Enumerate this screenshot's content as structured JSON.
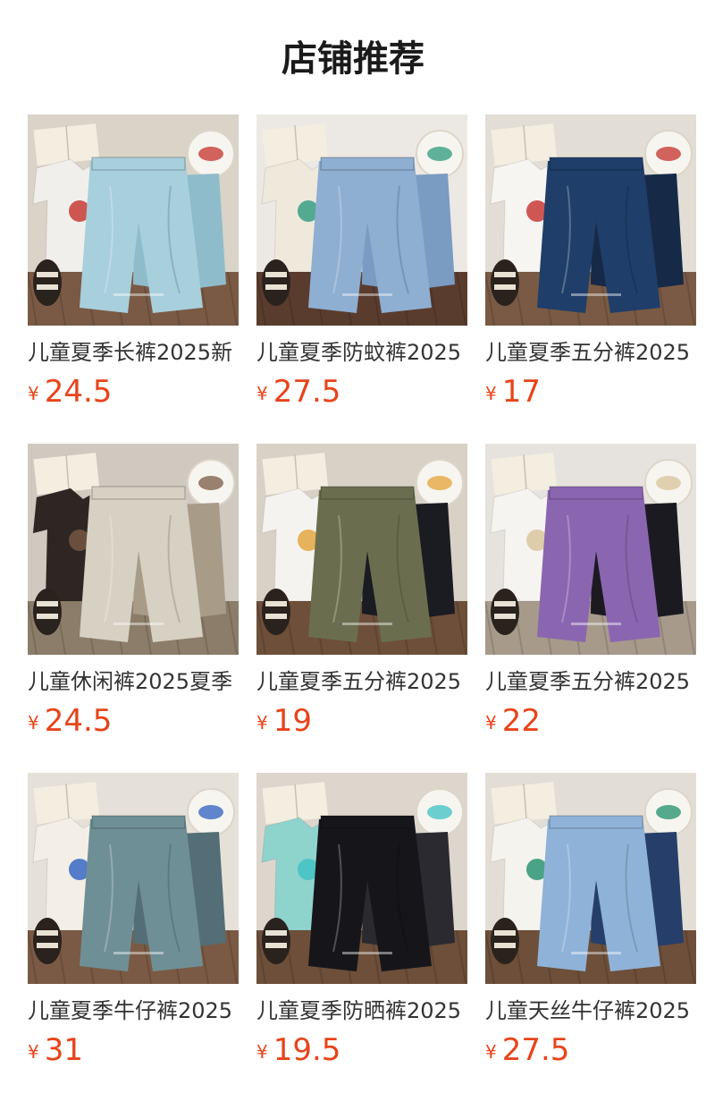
{
  "header": {
    "title": "店铺推荐"
  },
  "currency_symbol": "¥",
  "products": [
    {
      "name": "儿童夏季长裤2025新",
      "price": "24.5",
      "image": "light-blue-pants-photo",
      "colors": {
        "bg": "#d9d3c8",
        "floor": "#7a5a44",
        "garment": "#a8cfdc",
        "garment2": "#8fbccb",
        "shirt": "#f1efeb",
        "accent": "#c4302b"
      }
    },
    {
      "name": "儿童夏季防蚊裤2025",
      "price": "27.5",
      "image": "denim-jogger-photo",
      "colors": {
        "bg": "#ece9e4",
        "floor": "#5a3c2e",
        "garment": "#8eaed2",
        "garment2": "#7a9bc2",
        "shirt": "#efe9dc",
        "accent": "#2c9a7e"
      }
    },
    {
      "name": "儿童夏季五分裤2025",
      "price": "17",
      "image": "navy-shorts-photo",
      "colors": {
        "bg": "#e2ddd5",
        "floor": "#7a5a44",
        "garment": "#1f3e6a",
        "garment2": "#162a47",
        "shirt": "#f6f5f2",
        "accent": "#c4302b"
      }
    },
    {
      "name": "儿童休闲裤2025夏季",
      "price": "24.5",
      "image": "beige-cargo-pants-photo",
      "colors": {
        "bg": "#cfc9bf",
        "floor": "#8c7d6a",
        "garment": "#d6d1c3",
        "garment2": "#a89c88",
        "shirt": "#2d2623",
        "accent": "#7a5a44"
      }
    },
    {
      "name": "儿童夏季五分裤2025",
      "price": "19",
      "image": "olive-cargo-shorts-photo",
      "colors": {
        "bg": "#d8d2c6",
        "floor": "#6d4f3a",
        "garment": "#6b6e4e",
        "garment2": "#1b1b22",
        "shirt": "#f5f3ef",
        "accent": "#e4a137"
      }
    },
    {
      "name": "儿童夏季五分裤2025",
      "price": "22",
      "image": "purple-cargo-shorts-photo",
      "colors": {
        "bg": "#e6e3de",
        "floor": "#a79a8b",
        "garment": "#8a66b0",
        "garment2": "#1c1a21",
        "shirt": "#f6f4f1",
        "accent": "#d8c39a"
      }
    },
    {
      "name": "儿童夏季牛仔裤2025",
      "price": "31",
      "image": "vintage-denim-shorts-photo",
      "colors": {
        "bg": "#e5e1d9",
        "floor": "#7a5a44",
        "garment": "#6f8f96",
        "garment2": "#536e76",
        "shirt": "#f3efe6",
        "accent": "#2d5fc2"
      }
    },
    {
      "name": "儿童夏季防晒裤2025",
      "price": "19.5",
      "image": "black-track-pants-photo",
      "colors": {
        "bg": "#dcd6cd",
        "floor": "#6d4f3a",
        "garment": "#16161a",
        "garment2": "#2a2a30",
        "shirt": "#8fd3cd",
        "accent": "#3cc0c4"
      }
    },
    {
      "name": "儿童天丝牛仔裤2025",
      "price": "27.5",
      "image": "tencel-denim-pants-photo",
      "colors": {
        "bg": "#e3ded5",
        "floor": "#6d4f3a",
        "garment": "#8fb3d8",
        "garment2": "#263f6a",
        "shirt": "#f5f3ee",
        "accent": "#1f8f6c"
      }
    }
  ]
}
